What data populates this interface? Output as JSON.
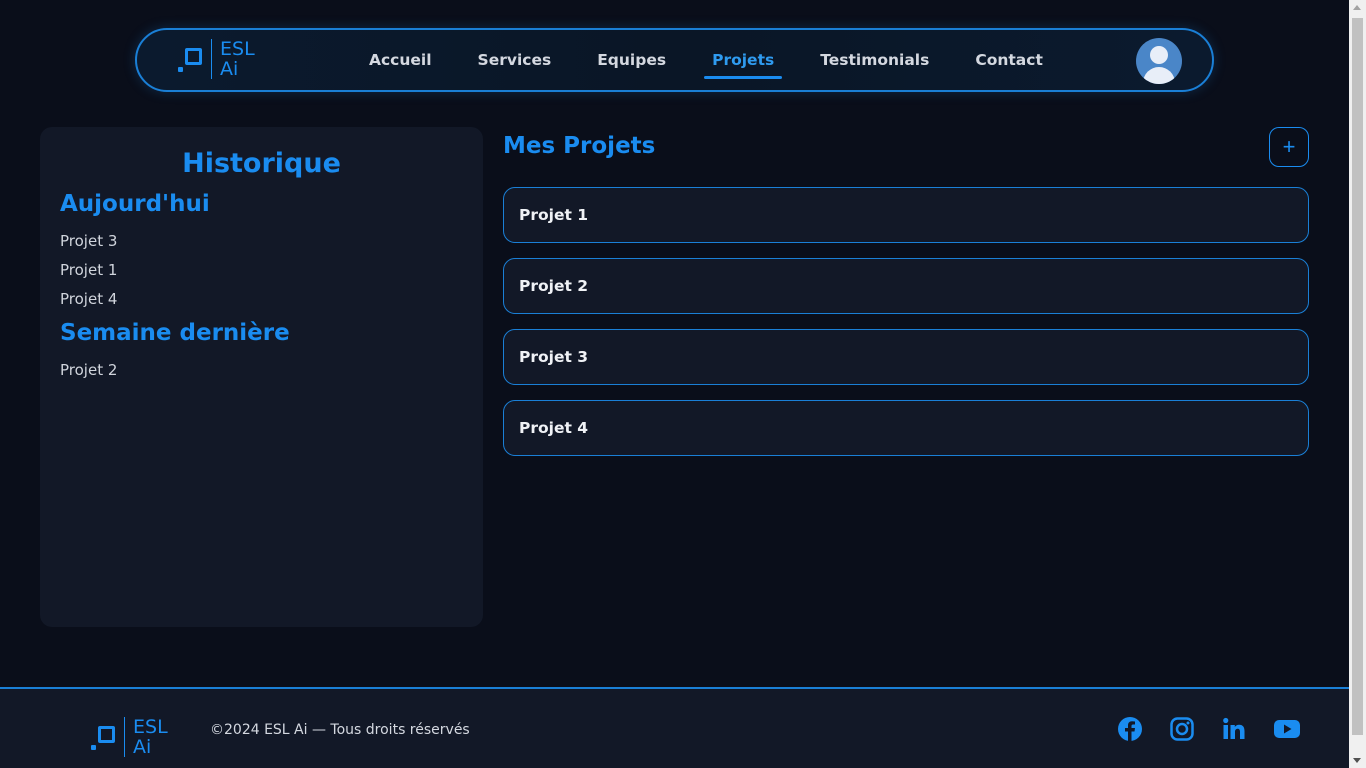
{
  "brand": {
    "line1": "ESL",
    "line2": "Ai"
  },
  "nav": {
    "items": [
      {
        "label": "Accueil",
        "active": false
      },
      {
        "label": "Services",
        "active": false
      },
      {
        "label": "Equipes",
        "active": false
      },
      {
        "label": "Projets",
        "active": true
      },
      {
        "label": "Testimonials",
        "active": false
      },
      {
        "label": "Contact",
        "active": false
      }
    ]
  },
  "history": {
    "title": "Historique",
    "groups": [
      {
        "title": "Aujourd'hui",
        "items": [
          "Projet 3",
          "Projet 1",
          "Projet 4"
        ]
      },
      {
        "title": "Semaine dernière",
        "items": [
          "Projet 2"
        ]
      }
    ]
  },
  "projects": {
    "title": "Mes Projets",
    "add_label": "+",
    "items": [
      "Projet 1",
      "Projet 2",
      "Projet 3",
      "Projet 4"
    ]
  },
  "footer": {
    "copyright": "©2024 ESL Ai — Tous droits réservés",
    "socials": [
      "facebook-icon",
      "instagram-icon",
      "linkedin-icon",
      "youtube-icon"
    ]
  },
  "colors": {
    "accent": "#1a8cf0",
    "background": "#0a0e1a",
    "panel": "#121827"
  }
}
